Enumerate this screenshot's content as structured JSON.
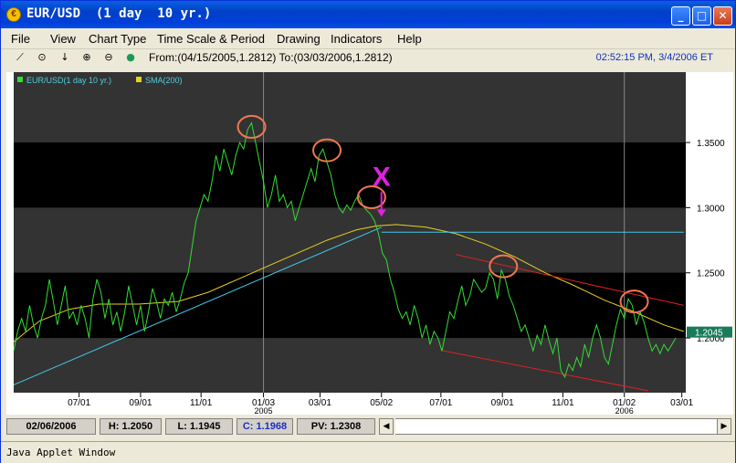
{
  "window": {
    "title": "EUR/USD  (1 day  10 yr.)",
    "title_icon": "currency-icon"
  },
  "menu": [
    "File",
    "View",
    "Chart Type",
    "Time Scale & Period",
    "Drawing",
    "Indicators",
    "Help"
  ],
  "toolbar": {
    "range": "From:(04/15/2005,1.2812) To:(03/03/2006,1.2812)",
    "clock": "02:52:15 PM, 3/4/2006 ET",
    "tools": [
      "line-draw-icon",
      "crosshair-icon",
      "arrow-down-icon",
      "zoom-in-icon",
      "zoom-out-icon",
      "dot-icon"
    ]
  },
  "chart_data": {
    "type": "line",
    "legend": [
      {
        "name": "EUR/USD(1 day  10 yr.)",
        "color": "#33dd33"
      },
      {
        "name": "SMA(200)",
        "color": "#e8d020"
      }
    ],
    "y_ticks": [
      "1.3500",
      "1.3000",
      "1.2500",
      "1.2000"
    ],
    "ylim": [
      1.158,
      1.404
    ],
    "x_ticks": [
      {
        "label": "07/01",
        "day": 0
      },
      {
        "label": "09/01",
        "day": 62
      },
      {
        "label": "11/01",
        "day": 123
      },
      {
        "label": "01/03",
        "sub": "2005",
        "day": 186
      },
      {
        "label": "03/01",
        "day": 243
      },
      {
        "label": "05/02",
        "day": 305
      },
      {
        "label": "07/01",
        "day": 365
      },
      {
        "label": "09/01",
        "day": 427
      },
      {
        "label": "11/01",
        "day": 488
      },
      {
        "label": "01/02",
        "sub": "2006",
        "day": 550
      },
      {
        "label": "03/01",
        "day": 608
      }
    ],
    "last_price": "1.2045",
    "last_price_color": "#1a7a5a",
    "colors": {
      "price": "#33dd33",
      "sma": "#e8d020",
      "trend": "#40c8e8",
      "channel": "#e02020",
      "circle": "#f07850",
      "marker": "#e020e0"
    },
    "price_points": [
      [
        -66,
        1.19
      ],
      [
        -62,
        1.205
      ],
      [
        -58,
        1.215
      ],
      [
        -54,
        1.205
      ],
      [
        -50,
        1.225
      ],
      [
        -46,
        1.21
      ],
      [
        -42,
        1.2
      ],
      [
        -38,
        1.215
      ],
      [
        -34,
        1.225
      ],
      [
        -30,
        1.245
      ],
      [
        -26,
        1.228
      ],
      [
        -22,
        1.21
      ],
      [
        -18,
        1.225
      ],
      [
        -14,
        1.24
      ],
      [
        -10,
        1.215
      ],
      [
        -6,
        1.22
      ],
      [
        -2,
        1.21
      ],
      [
        2,
        1.225
      ],
      [
        6,
        1.215
      ],
      [
        10,
        1.2
      ],
      [
        14,
        1.23
      ],
      [
        18,
        1.245
      ],
      [
        22,
        1.235
      ],
      [
        26,
        1.215
      ],
      [
        30,
        1.23
      ],
      [
        34,
        1.21
      ],
      [
        38,
        1.22
      ],
      [
        42,
        1.205
      ],
      [
        46,
        1.22
      ],
      [
        50,
        1.24
      ],
      [
        54,
        1.225
      ],
      [
        58,
        1.21
      ],
      [
        62,
        1.225
      ],
      [
        66,
        1.205
      ],
      [
        70,
        1.22
      ],
      [
        74,
        1.238
      ],
      [
        78,
        1.228
      ],
      [
        82,
        1.215
      ],
      [
        86,
        1.23
      ],
      [
        90,
        1.225
      ],
      [
        94,
        1.235
      ],
      [
        98,
        1.22
      ],
      [
        102,
        1.23
      ],
      [
        106,
        1.242
      ],
      [
        110,
        1.25
      ],
      [
        114,
        1.27
      ],
      [
        118,
        1.29
      ],
      [
        122,
        1.3
      ],
      [
        126,
        1.31
      ],
      [
        130,
        1.305
      ],
      [
        134,
        1.32
      ],
      [
        138,
        1.34
      ],
      [
        142,
        1.328
      ],
      [
        146,
        1.345
      ],
      [
        150,
        1.335
      ],
      [
        154,
        1.325
      ],
      [
        158,
        1.34
      ],
      [
        162,
        1.35
      ],
      [
        166,
        1.345
      ],
      [
        170,
        1.36
      ],
      [
        174,
        1.365
      ],
      [
        178,
        1.35
      ],
      [
        182,
        1.335
      ],
      [
        186,
        1.32
      ],
      [
        190,
        1.3
      ],
      [
        194,
        1.31
      ],
      [
        198,
        1.325
      ],
      [
        202,
        1.305
      ],
      [
        206,
        1.31
      ],
      [
        210,
        1.3
      ],
      [
        214,
        1.305
      ],
      [
        218,
        1.29
      ],
      [
        222,
        1.3
      ],
      [
        226,
        1.31
      ],
      [
        230,
        1.32
      ],
      [
        234,
        1.33
      ],
      [
        238,
        1.32
      ],
      [
        242,
        1.34
      ],
      [
        246,
        1.345
      ],
      [
        250,
        1.335
      ],
      [
        254,
        1.325
      ],
      [
        258,
        1.31
      ],
      [
        262,
        1.3
      ],
      [
        266,
        1.296
      ],
      [
        270,
        1.302
      ],
      [
        274,
        1.298
      ],
      [
        278,
        1.305
      ],
      [
        282,
        1.31
      ],
      [
        286,
        1.302
      ],
      [
        290,
        1.298
      ],
      [
        294,
        1.295
      ],
      [
        298,
        1.29
      ],
      [
        302,
        1.28
      ],
      [
        306,
        1.265
      ],
      [
        310,
        1.26
      ],
      [
        314,
        1.245
      ],
      [
        318,
        1.235
      ],
      [
        322,
        1.222
      ],
      [
        326,
        1.215
      ],
      [
        330,
        1.22
      ],
      [
        334,
        1.21
      ],
      [
        338,
        1.225
      ],
      [
        342,
        1.215
      ],
      [
        346,
        1.2
      ],
      [
        350,
        1.21
      ],
      [
        354,
        1.195
      ],
      [
        358,
        1.205
      ],
      [
        362,
        1.2
      ],
      [
        366,
        1.19
      ],
      [
        370,
        1.205
      ],
      [
        374,
        1.22
      ],
      [
        378,
        1.215
      ],
      [
        382,
        1.228
      ],
      [
        386,
        1.24
      ],
      [
        390,
        1.225
      ],
      [
        394,
        1.232
      ],
      [
        398,
        1.245
      ],
      [
        402,
        1.24
      ],
      [
        406,
        1.235
      ],
      [
        410,
        1.238
      ],
      [
        414,
        1.25
      ],
      [
        418,
        1.245
      ],
      [
        422,
        1.23
      ],
      [
        426,
        1.252
      ],
      [
        430,
        1.245
      ],
      [
        434,
        1.232
      ],
      [
        438,
        1.225
      ],
      [
        442,
        1.215
      ],
      [
        446,
        1.205
      ],
      [
        450,
        1.21
      ],
      [
        454,
        1.2
      ],
      [
        458,
        1.19
      ],
      [
        462,
        1.202
      ],
      [
        466,
        1.195
      ],
      [
        470,
        1.21
      ],
      [
        474,
        1.198
      ],
      [
        478,
        1.188
      ],
      [
        482,
        1.2
      ],
      [
        486,
        1.175
      ],
      [
        490,
        1.17
      ],
      [
        494,
        1.18
      ],
      [
        498,
        1.175
      ],
      [
        502,
        1.185
      ],
      [
        506,
        1.178
      ],
      [
        510,
        1.195
      ],
      [
        514,
        1.185
      ],
      [
        518,
        1.2
      ],
      [
        522,
        1.21
      ],
      [
        526,
        1.2
      ],
      [
        530,
        1.185
      ],
      [
        534,
        1.18
      ],
      [
        538,
        1.195
      ],
      [
        542,
        1.21
      ],
      [
        546,
        1.222
      ],
      [
        550,
        1.215
      ],
      [
        554,
        1.23
      ],
      [
        558,
        1.225
      ],
      [
        562,
        1.21
      ],
      [
        566,
        1.22
      ],
      [
        570,
        1.212
      ],
      [
        574,
        1.2
      ],
      [
        578,
        1.19
      ],
      [
        582,
        1.195
      ],
      [
        586,
        1.188
      ],
      [
        590,
        1.195
      ],
      [
        594,
        1.19
      ],
      [
        598,
        1.195
      ],
      [
        602,
        1.2
      ]
    ],
    "sma_points": [
      [
        -66,
        1.197
      ],
      [
        -40,
        1.213
      ],
      [
        -10,
        1.222
      ],
      [
        20,
        1.226
      ],
      [
        60,
        1.226
      ],
      [
        100,
        1.228
      ],
      [
        130,
        1.235
      ],
      [
        160,
        1.245
      ],
      [
        190,
        1.255
      ],
      [
        220,
        1.265
      ],
      [
        250,
        1.275
      ],
      [
        280,
        1.283
      ],
      [
        300,
        1.286
      ],
      [
        320,
        1.287
      ],
      [
        350,
        1.285
      ],
      [
        380,
        1.28
      ],
      [
        410,
        1.272
      ],
      [
        440,
        1.262
      ],
      [
        470,
        1.25
      ],
      [
        500,
        1.24
      ],
      [
        530,
        1.229
      ],
      [
        560,
        1.22
      ],
      [
        590,
        1.21
      ],
      [
        610,
        1.205
      ]
    ],
    "annotations": {
      "trend_line": [
        [
          -66,
          1.164
        ],
        [
          305,
          1.285
        ]
      ],
      "horizontal_line": [
        [
          305,
          1.2812
        ],
        [
          610,
          1.2812
        ]
      ],
      "lower_channel": [
        [
          365,
          1.1905
        ],
        [
          574,
          1.1595
        ]
      ],
      "upper_channel": [
        [
          380,
          1.264
        ],
        [
          610,
          1.225
        ]
      ],
      "circles": [
        [
          174,
          1.362
        ],
        [
          250,
          1.344
        ],
        [
          295,
          1.308
        ],
        [
          428,
          1.255
        ],
        [
          560,
          1.228
        ]
      ],
      "arrow_from": [
        305,
        1.312
      ],
      "arrow_to": [
        305,
        1.293
      ],
      "x_label": "X",
      "x_label_at": [
        305,
        1.325
      ]
    },
    "vertical_guides": [
      186,
      550
    ]
  },
  "status": {
    "date": "02/06/2006",
    "high": "H: 1.2050",
    "low": "L: 1.1945",
    "close": "C: 1.1968",
    "pv": "PV: 1.2308"
  },
  "footer": "Java Applet Window"
}
